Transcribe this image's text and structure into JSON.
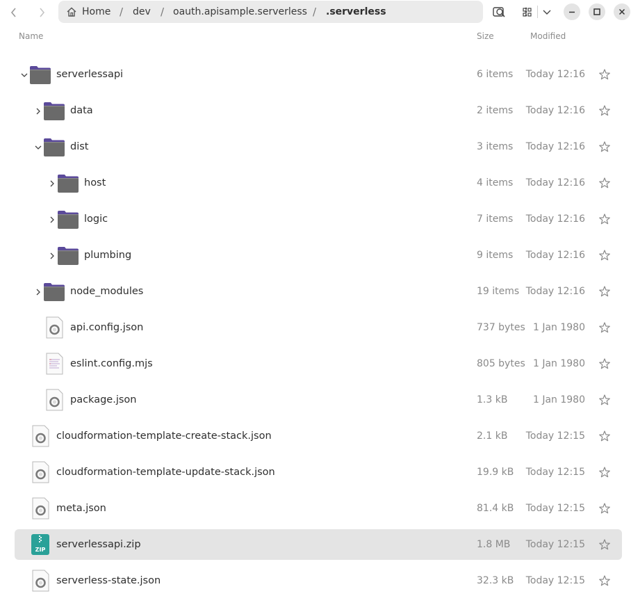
{
  "header": {
    "breadcrumbs": [
      "Home",
      "dev",
      "oauth.apisample.serverless",
      ".serverless"
    ],
    "separator": "/"
  },
  "columns": {
    "name": "Name",
    "size": "Size",
    "modified": "Modified"
  },
  "rows": [
    {
      "name": "serverlessapi",
      "size": "6 items",
      "modified": "Today 12:16",
      "type": "folder",
      "indent": 0,
      "expander": "expanded"
    },
    {
      "name": "data",
      "size": "2 items",
      "modified": "Today 12:16",
      "type": "folder",
      "indent": 1,
      "expander": "collapsed"
    },
    {
      "name": "dist",
      "size": "3 items",
      "modified": "Today 12:16",
      "type": "folder",
      "indent": 1,
      "expander": "expanded"
    },
    {
      "name": "host",
      "size": "4 items",
      "modified": "Today 12:16",
      "type": "folder",
      "indent": 2,
      "expander": "collapsed"
    },
    {
      "name": "logic",
      "size": "7 items",
      "modified": "Today 12:16",
      "type": "folder",
      "indent": 2,
      "expander": "collapsed"
    },
    {
      "name": "plumbing",
      "size": "9 items",
      "modified": "Today 12:16",
      "type": "folder",
      "indent": 2,
      "expander": "collapsed"
    },
    {
      "name": "node_modules",
      "size": "19 items",
      "modified": "Today 12:16",
      "type": "folder",
      "indent": 1,
      "expander": "collapsed"
    },
    {
      "name": "api.config.json",
      "size": "737 bytes",
      "modified": "1 Jan 1980",
      "type": "json",
      "indent": 1,
      "expander": "none"
    },
    {
      "name": "eslint.config.mjs",
      "size": "805 bytes",
      "modified": "1 Jan 1980",
      "type": "text",
      "indent": 1,
      "expander": "none"
    },
    {
      "name": "package.json",
      "size": "1.3 kB",
      "modified": "1 Jan 1980",
      "type": "json",
      "indent": 1,
      "expander": "none"
    },
    {
      "name": "cloudformation-template-create-stack.json",
      "size": "2.1 kB",
      "modified": "Today 12:15",
      "type": "json",
      "indent": 0,
      "expander": "none"
    },
    {
      "name": "cloudformation-template-update-stack.json",
      "size": "19.9 kB",
      "modified": "Today 12:15",
      "type": "json",
      "indent": 0,
      "expander": "none"
    },
    {
      "name": "meta.json",
      "size": "81.4 kB",
      "modified": "Today 12:15",
      "type": "json",
      "indent": 0,
      "expander": "none"
    },
    {
      "name": "serverlessapi.zip",
      "size": "1.8 MB",
      "modified": "Today 12:15",
      "type": "zip",
      "indent": 0,
      "expander": "none",
      "selected": true
    },
    {
      "name": "serverless-state.json",
      "size": "32.3 kB",
      "modified": "Today 12:15",
      "type": "json",
      "indent": 0,
      "expander": "none"
    }
  ],
  "icons": {
    "back": "back-icon",
    "forward": "forward-icon",
    "home": "home-icon",
    "menu": "kebab-menu-icon",
    "search": "search-icon",
    "view": "grid-view-icon",
    "view_options": "chevron-down-icon",
    "minimize": "minimize-icon",
    "maximize": "maximize-icon",
    "close": "close-icon",
    "star": "star-icon"
  },
  "zip_label": "ZIP",
  "colors": {
    "selected_row": "#e4e4e4",
    "folder": "#6a6a6a",
    "folder_tab": "#5b4a9a",
    "zip_icon": "#2aa198"
  }
}
